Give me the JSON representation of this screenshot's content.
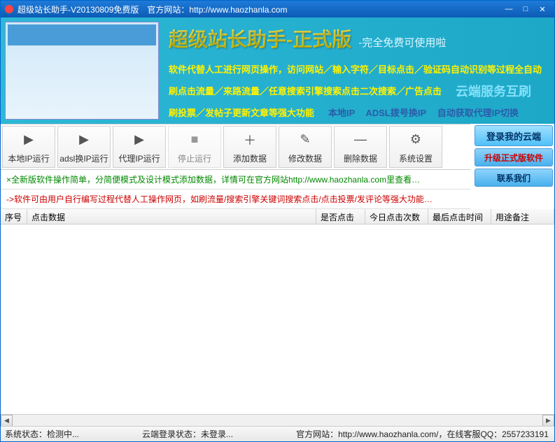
{
  "titlebar": {
    "title": "超级站长助手-V20130809免费版　官方网站：http://www.haozhanla.com"
  },
  "banner": {
    "title": "超级站长助手-正式版",
    "subtitle": "-完全免费可使用啦",
    "line1": "软件代替人工进行网页操作，访问网站／输入字符／目标点击／验证码自动识别等过程全自动",
    "line2": "刷点击流量／来路流量／任意搜索引擎搜索点击二次搜索／广告点击",
    "line3": "刷投票／发帖子更新文章等强大功能",
    "cloud": "云端服务互刷",
    "ip1": "本地IP",
    "ip2": "ADSL拨号换IP",
    "ip3": "自动获取代理IP切换"
  },
  "toolbar": {
    "btn1": "本地IP运行",
    "btn2": "adsl换IP运行",
    "btn3": "代理IP运行",
    "btn4": "停止运行",
    "btn5": "添加数据",
    "btn6": "修改数据",
    "btn7": "删除数据",
    "btn8": "系统设置"
  },
  "sideBtns": {
    "login": "登录我的云端",
    "upgrade": "升级正式版软件",
    "contact": "联系我们"
  },
  "infoLines": {
    "line1": "×全新版软件操作简单，分简便模式及设计模式添加数据，详情可在官方网站http://www.haozhanla.com里查看…",
    "line2": "->软件可由用户自行编写过程代替人工操作网页，如刷流量/搜索引擎关键词搜索点击/点击投票/发评论等强大功能…"
  },
  "table": {
    "col1": "序号",
    "col2": "点击数据",
    "col3": "是否点击",
    "col4": "今日点击次数",
    "col5": "最后点击时间",
    "col6": "用途备注"
  },
  "statusbar": {
    "s1": "系统状态：",
    "s1v": "检测中...",
    "s2": "云端登录状态：",
    "s2v": "未登录...",
    "s3": "官方网站：http://www.haozhanla.com/，在线客服QQ：2557233191"
  }
}
